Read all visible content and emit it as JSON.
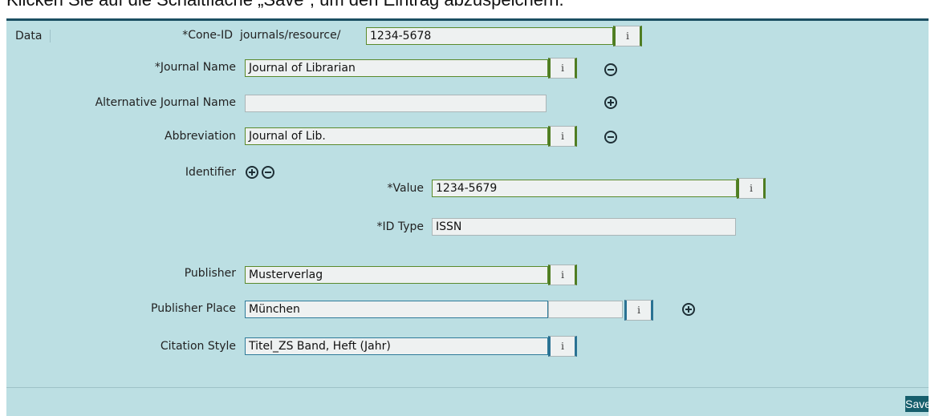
{
  "caption": "Klicken Sie auf die Schaltfläche „Save“, um den Eintrag abzuspeichern.",
  "tab": {
    "label": "Data"
  },
  "fields": {
    "cone_id": {
      "label": "*Cone-ID",
      "prefix": "journals/resource/",
      "value": "1234-5678"
    },
    "journal_name": {
      "label": "*Journal Name",
      "value": "Journal of Librarian"
    },
    "alt_journal_name": {
      "label": "Alternative Journal Name",
      "value": ""
    },
    "abbreviation": {
      "label": "Abbreviation",
      "value": "Journal of Lib."
    },
    "identifier": {
      "label": "Identifier"
    },
    "identifier_value": {
      "label": "*Value",
      "value": "1234-5679"
    },
    "identifier_type": {
      "label": "*ID Type",
      "value": "ISSN"
    },
    "publisher": {
      "label": "Publisher",
      "value": "Musterverlag"
    },
    "publisher_place": {
      "label": "Publisher Place",
      "value": "München",
      "extra_value": ""
    },
    "citation_style": {
      "label": "Citation Style",
      "value": "Titel_ZS Band, Heft (Jahr)"
    }
  },
  "info_button_label": "i",
  "save_label": "Save",
  "colors": {
    "panel_bg": "#bcdfe3",
    "header_rule": "#1b4f62",
    "save_bg": "#165e6c",
    "green_border": "#5a8a2c",
    "blue_border": "#2f7b9a"
  }
}
